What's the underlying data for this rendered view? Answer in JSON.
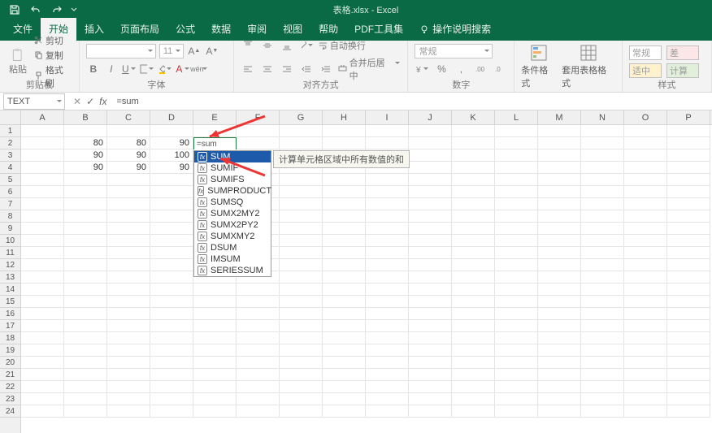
{
  "title": "表格.xlsx - Excel",
  "tabs": [
    "文件",
    "开始",
    "插入",
    "页面布局",
    "公式",
    "数据",
    "审阅",
    "视图",
    "帮助",
    "PDF工具集"
  ],
  "activeTab": 1,
  "tellMe": "操作说明搜索",
  "clipboard": {
    "label": "剪贴板",
    "paste": "粘贴",
    "cut": "剪切",
    "copy": "复制",
    "format": "格式刷"
  },
  "font": {
    "label": "字体",
    "size": "11"
  },
  "align": {
    "label": "对齐方式",
    "wrap": "自动换行",
    "merge": "合并后居中"
  },
  "number": {
    "label": "数字",
    "format": "常规"
  },
  "styles": {
    "cond": "条件格式",
    "table": "套用表格格式"
  },
  "cells": {
    "label": "样式",
    "general": "常规",
    "applied": "适中",
    "neutral": "差",
    "calc": "计算"
  },
  "namebox": "TEXT",
  "formula": "=sum",
  "cols": [
    "A",
    "B",
    "C",
    "D",
    "E",
    "F",
    "G",
    "H",
    "I",
    "J",
    "K",
    "L",
    "M",
    "N",
    "O",
    "P"
  ],
  "rowcount": 24,
  "data": [
    {
      "B": "80",
      "C": "80",
      "D": "90",
      "E_edit": "=sum"
    },
    {
      "B": "90",
      "C": "90",
      "D": "100"
    },
    {
      "B": "90",
      "C": "90",
      "D": "90"
    }
  ],
  "autocomplete": {
    "items": [
      "SUM",
      "SUMIF",
      "SUMIFS",
      "SUMPRODUCT",
      "SUMSQ",
      "SUMX2MY2",
      "SUMX2PY2",
      "SUMXMY2",
      "DSUM",
      "IMSUM",
      "SERIESSUM"
    ],
    "selected": 0
  },
  "tooltip": "计算单元格区域中所有数值的和"
}
